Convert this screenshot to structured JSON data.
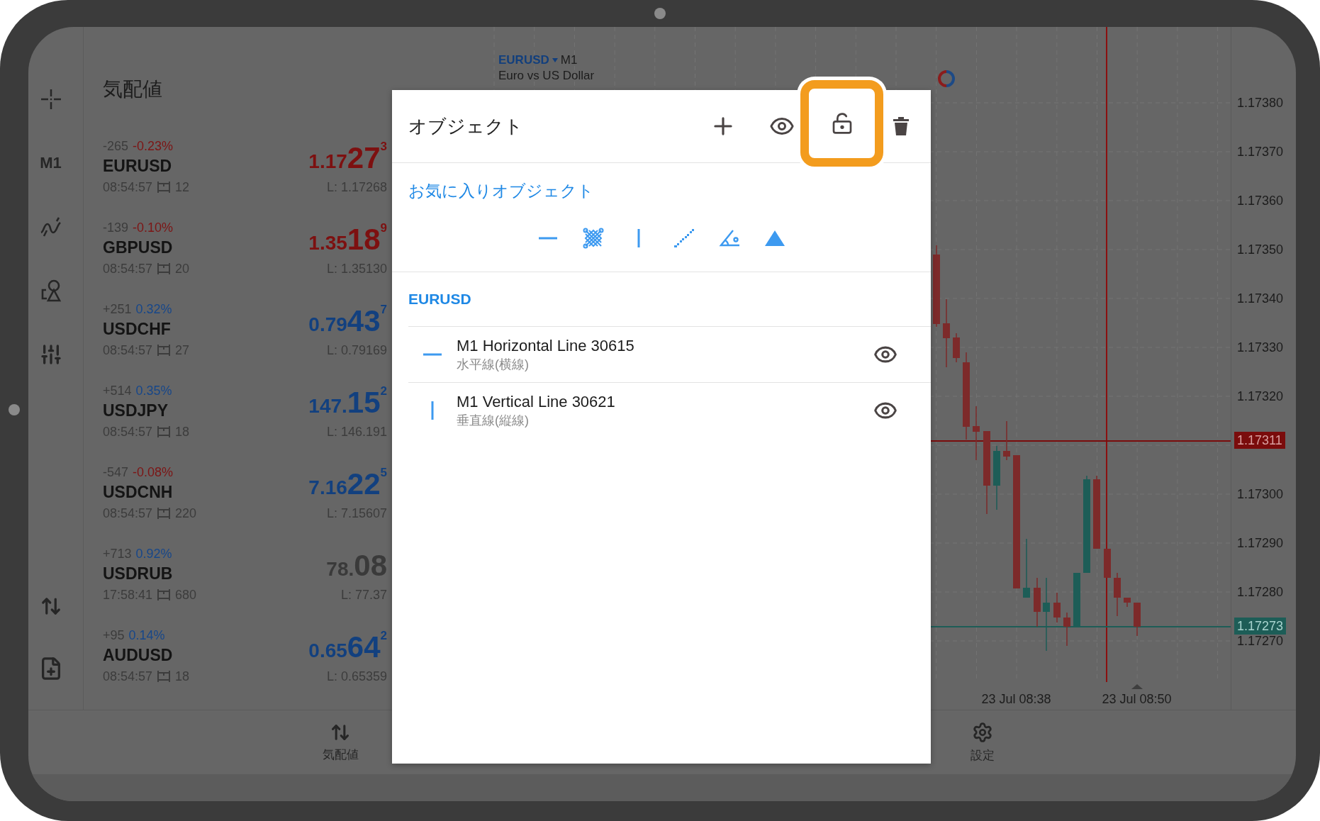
{
  "rail": {
    "timeframe": "M1"
  },
  "quotes": {
    "title": "気配値",
    "rows": [
      {
        "change": "-265",
        "percent": {
          "text": "-0.23%",
          "color": "#7d1515"
        },
        "symbol": "EURUSD",
        "time": "08:54:57",
        "spread": "12",
        "price": {
          "main": "1.17",
          "big": "27",
          "sup": "3",
          "color": "#7d1010"
        },
        "low": "L: 1.17268"
      },
      {
        "change": "-139",
        "percent": {
          "text": "-0.10%",
          "color": "#7d1515"
        },
        "symbol": "GBPUSD",
        "time": "08:54:57",
        "spread": "20",
        "price": {
          "main": "1.35",
          "big": "18",
          "sup": "9",
          "color": "#7d1010"
        },
        "low": "L: 1.35130"
      },
      {
        "change": "+251",
        "percent": {
          "text": "0.32%",
          "color": "#17478a"
        },
        "symbol": "USDCHF",
        "time": "08:54:57",
        "spread": "27",
        "price": {
          "main": "0.79",
          "big": "43",
          "sup": "7",
          "color": "#12407f"
        },
        "low": "L: 0.79169"
      },
      {
        "change": "+514",
        "percent": {
          "text": "0.35%",
          "color": "#17478a"
        },
        "symbol": "USDJPY",
        "time": "08:54:57",
        "spread": "18",
        "price": {
          "main": "147.",
          "big": "15",
          "sup": "2",
          "color": "#12407f"
        },
        "low": "L: 146.191"
      },
      {
        "change": "-547",
        "percent": {
          "text": "-0.08%",
          "color": "#7d1515"
        },
        "symbol": "USDCNH",
        "time": "08:54:57",
        "spread": "220",
        "price": {
          "main": "7.16",
          "big": "22",
          "sup": "5",
          "color": "#12407f"
        },
        "low": "L: 7.15607"
      },
      {
        "change": "+713",
        "percent": {
          "text": "0.92%",
          "color": "#17478a"
        },
        "symbol": "USDRUB",
        "time": "17:58:41",
        "spread": "680",
        "price": {
          "main": "78.",
          "big": "08",
          "color": "#3a3a3a"
        },
        "low": "L: 77.37"
      },
      {
        "change": "+95",
        "percent": {
          "text": "0.14%",
          "color": "#17478a"
        },
        "symbol": "AUDUSD",
        "time": "08:54:57",
        "spread": "18",
        "price": {
          "main": "0.65",
          "big": "64",
          "sup": "2",
          "color": "#12407f"
        },
        "low": "L: 0.65359"
      }
    ]
  },
  "chart": {
    "symbol": "EURUSD",
    "timeframe": "M1",
    "description": "Euro vs US Dollar",
    "price_labels": [
      {
        "text": "1.17380",
        "kind": "tick"
      },
      {
        "text": "1.17370",
        "kind": "tick"
      },
      {
        "text": "1.17360",
        "kind": "tick"
      },
      {
        "text": "1.17350",
        "kind": "tick"
      },
      {
        "text": "1.17340",
        "kind": "tick"
      },
      {
        "text": "1.17330",
        "kind": "tick"
      },
      {
        "text": "1.17320",
        "kind": "tick"
      },
      {
        "text": "1.17311",
        "kind": "sell"
      },
      {
        "text": "1.17300",
        "kind": "tick"
      },
      {
        "text": "1.17290",
        "kind": "tick"
      },
      {
        "text": "1.17280",
        "kind": "tick"
      },
      {
        "text": "1.17273",
        "kind": "buy"
      },
      {
        "text": "1.17270",
        "kind": "tick"
      }
    ],
    "time_labels": [
      "23 Jul 08:38",
      "23 Jul 08:50"
    ]
  },
  "bottom_nav": [
    {
      "kind": "quotes",
      "label": "気配値"
    },
    {
      "kind": "settings",
      "label": "設定"
    }
  ],
  "dialog": {
    "title": "オブジェクト",
    "actions": [
      {
        "kind": "add",
        "highlighted": false
      },
      {
        "kind": "visibility",
        "highlighted": false
      },
      {
        "kind": "lock",
        "highlighted": true
      },
      {
        "kind": "delete",
        "highlighted": false
      }
    ],
    "favorites_title": "お気に入りオブジェクト",
    "favorites": [
      {
        "kind": "hline"
      },
      {
        "kind": "gann"
      },
      {
        "kind": "vline"
      },
      {
        "kind": "dots"
      },
      {
        "kind": "angle"
      },
      {
        "kind": "triangle"
      }
    ],
    "group": "EURUSD",
    "objects": [
      {
        "kind": "hline",
        "name": "M1 Horizontal Line 30615",
        "type": "水平線(横線)",
        "visible": true
      },
      {
        "kind": "vline",
        "name": "M1 Vertical Line 30621",
        "type": "垂直線(縦線)",
        "visible": true
      }
    ]
  }
}
